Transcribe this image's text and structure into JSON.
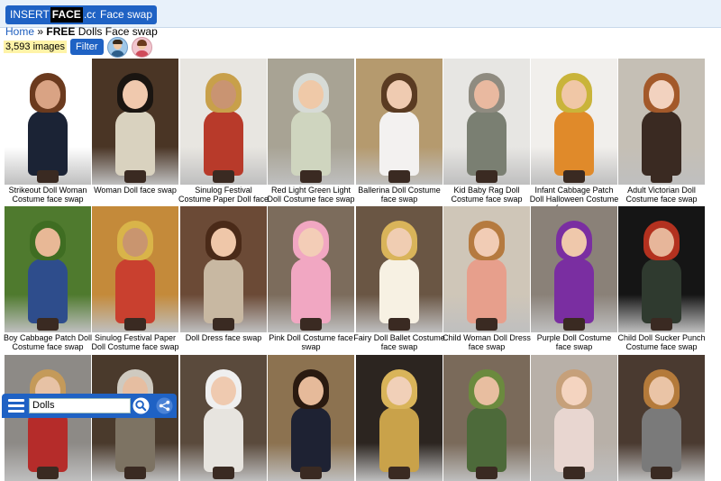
{
  "header": {
    "logo_left": "INSERT",
    "logo_mid": "FACE",
    "logo_right": ".com",
    "face_swap_button": "Face swap"
  },
  "breadcrumb": {
    "home": "Home",
    "separator": "»",
    "bold": "FREE",
    "current": "Dolls Face swap"
  },
  "toolbar": {
    "count": "3,593 images",
    "filter_label": "Filter",
    "avatar_male_icon": "man-avatar-icon",
    "avatar_female_icon": "woman-avatar-icon"
  },
  "gallery": [
    {
      "caption": "Strikeout Doll Woman Costume face swap",
      "bg": "#ffffff",
      "cloth": "#1b2335",
      "skin": "#d9a384",
      "hair": "#6b3a1e"
    },
    {
      "caption": "Woman Doll face swap",
      "bg": "#4a3525",
      "cloth": "#d9d2bf",
      "skin": "#f0c9ae",
      "hair": "#1a1511"
    },
    {
      "caption": "Sinulog Festival Costume Paper Doll face swap",
      "bg": "#e8e6e1",
      "cloth": "#b83a2a",
      "skin": "#c99472",
      "hair": "#c8a04a"
    },
    {
      "caption": "Red Light Green Light Doll Costume face swap",
      "bg": "#a8a394",
      "cloth": "#cfd5bf",
      "skin": "#efc9a8",
      "hair": "#d7dbd6"
    },
    {
      "caption": "Ballerina Doll Costume face swap",
      "bg": "#b59a6e",
      "cloth": "#f3f1f0",
      "skin": "#efcbb1",
      "hair": "#5a3b22"
    },
    {
      "caption": "Kid Baby Rag Doll Costume face swap",
      "bg": "#e7e6e3",
      "cloth": "#7a7f72",
      "skin": "#e9b9a0",
      "hair": "#8f8b80"
    },
    {
      "caption": "Infant Cabbage Patch Doll Halloween Costume face swap",
      "bg": "#f1efec",
      "cloth": "#e08a2a",
      "skin": "#f0c7a6",
      "hair": "#c9b43a"
    },
    {
      "caption": "Adult Victorian Doll Costume face swap",
      "bg": "#c5bfb5",
      "cloth": "#3a2a22",
      "skin": "#f2d2bf",
      "hair": "#a3592a"
    },
    {
      "caption": "Boy Cabbage Patch Doll Costume face swap",
      "bg": "#4f7a2e",
      "cloth": "#2e4d8c",
      "skin": "#e8b896",
      "hair": "#3f6d22"
    },
    {
      "caption": "Sinulog Festival Paper Doll Costume face swap",
      "bg": "#c48a3a",
      "cloth": "#c9402f",
      "skin": "#c9956f",
      "hair": "#d9b449"
    },
    {
      "caption": "Doll Dress face swap",
      "bg": "#6b4a36",
      "cloth": "#c8b8a2",
      "skin": "#efc7a9",
      "hair": "#4a2a18"
    },
    {
      "caption": "Pink Doll Costume face swap",
      "bg": "#7c6c5c",
      "cloth": "#f1a7c2",
      "skin": "#f3cdb7",
      "hair": "#f1a7c2"
    },
    {
      "caption": "Fairy Doll Ballet Costume face swap",
      "bg": "#6a5644",
      "cloth": "#f7f1e3",
      "skin": "#f0cdb2",
      "hair": "#d9b45a"
    },
    {
      "caption": "Child Woman Doll Dress face swap",
      "bg": "#cfc6b8",
      "cloth": "#e79f8c",
      "skin": "#f1ccb5",
      "hair": "#b57a3f"
    },
    {
      "caption": "Purple Doll Costume face swap",
      "bg": "#8a8178",
      "cloth": "#7a2ea1",
      "skin": "#efc8ab",
      "hair": "#7a2ea1"
    },
    {
      "caption": "Child Doll Sucker Punch Costume face swap",
      "bg": "#151515",
      "cloth": "#2f3a2f",
      "skin": "#e7b69a",
      "hair": "#b3311f"
    },
    {
      "caption": "",
      "bg": "#8d8a86",
      "cloth": "#b52c2a",
      "skin": "#e7c2a5",
      "hair": "#c49a5a"
    },
    {
      "caption": "",
      "bg": "#4a3a2c",
      "cloth": "#7d7363",
      "skin": "#e6bea1",
      "hair": "#cfcac0"
    },
    {
      "caption": "",
      "bg": "#5a4a3c",
      "cloth": "#e7e4df",
      "skin": "#efcab0",
      "hair": "#efefef"
    },
    {
      "caption": "",
      "bg": "#8c7250",
      "cloth": "#1e2233",
      "skin": "#e6ba9a",
      "hair": "#2a1a10"
    },
    {
      "caption": "",
      "bg": "#2c2520",
      "cloth": "#c9a24a",
      "skin": "#f1d0b8",
      "hair": "#d9b45a"
    },
    {
      "caption": "",
      "bg": "#7a6a5a",
      "cloth": "#4d6a3a",
      "skin": "#e8bea0",
      "hair": "#6b8a3e"
    },
    {
      "caption": "",
      "bg": "#b8b0a8",
      "cloth": "#e8d6d0",
      "skin": "#f4d4c0",
      "hair": "#c6a07a"
    },
    {
      "caption": "",
      "bg": "#4a3a30",
      "cloth": "#7a7a7a",
      "skin": "#eac4a6",
      "hair": "#b47a3a"
    }
  ],
  "search": {
    "value": "Dolls",
    "menu_icon": "hamburger-menu-icon",
    "search_icon": "magnifier-icon",
    "share_icon": "share-icon"
  }
}
